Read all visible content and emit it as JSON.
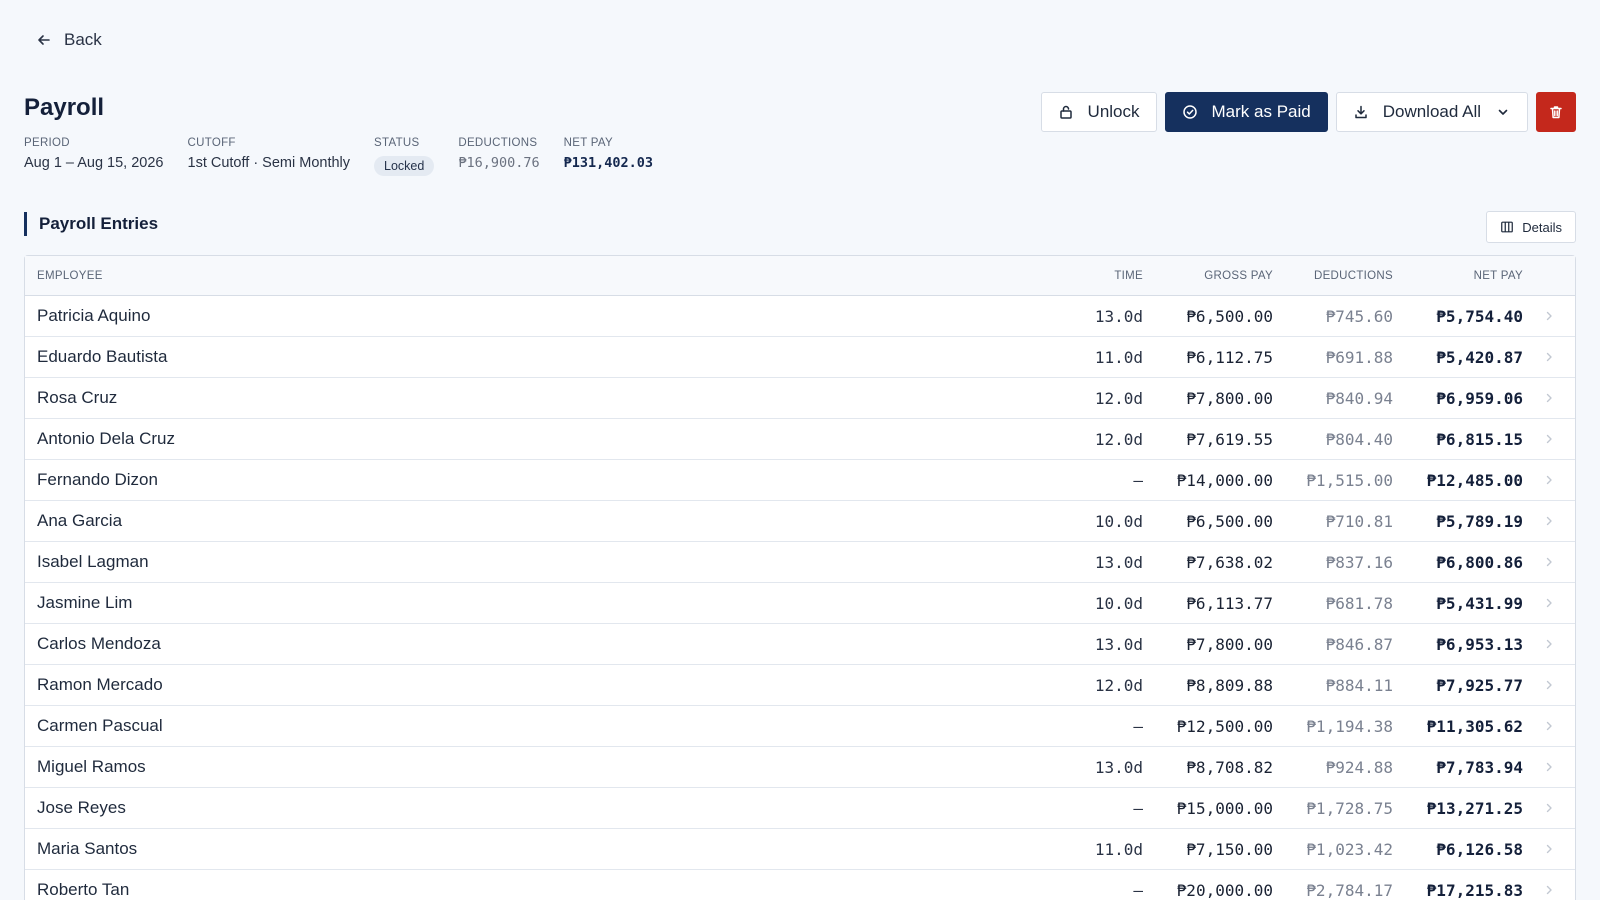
{
  "nav": {
    "back_label": "Back"
  },
  "page": {
    "title": "Payroll"
  },
  "meta": {
    "period": {
      "label": "PERIOD",
      "value": "Aug 1 – Aug 15, 2026"
    },
    "cutoff": {
      "label": "CUTOFF",
      "value": "1st Cutoff · Semi Monthly"
    },
    "status": {
      "label": "STATUS",
      "value": "Locked"
    },
    "deductions": {
      "label": "DEDUCTIONS",
      "value": "₱16,900.76"
    },
    "net_pay": {
      "label": "NET PAY",
      "value": "₱131,402.03"
    }
  },
  "actions": {
    "unlock_label": "Unlock",
    "mark_paid_label": "Mark as Paid",
    "download_label": "Download All",
    "delete_icon": "trash-icon"
  },
  "section": {
    "title": "Payroll Entries",
    "details_label": "Details"
  },
  "table": {
    "headers": {
      "employee": "EMPLOYEE",
      "time": "TIME",
      "gross": "GROSS PAY",
      "deductions": "DEDUCTIONS",
      "net": "NET PAY"
    },
    "rows": [
      {
        "name": "Patricia Aquino",
        "time": "13.0d",
        "gross": "₱6,500.00",
        "deductions": "₱745.60",
        "net": "₱5,754.40"
      },
      {
        "name": "Eduardo Bautista",
        "time": "11.0d",
        "gross": "₱6,112.75",
        "deductions": "₱691.88",
        "net": "₱5,420.87"
      },
      {
        "name": "Rosa Cruz",
        "time": "12.0d",
        "gross": "₱7,800.00",
        "deductions": "₱840.94",
        "net": "₱6,959.06"
      },
      {
        "name": "Antonio Dela Cruz",
        "time": "12.0d",
        "gross": "₱7,619.55",
        "deductions": "₱804.40",
        "net": "₱6,815.15"
      },
      {
        "name": "Fernando Dizon",
        "time": "–",
        "gross": "₱14,000.00",
        "deductions": "₱1,515.00",
        "net": "₱12,485.00"
      },
      {
        "name": "Ana Garcia",
        "time": "10.0d",
        "gross": "₱6,500.00",
        "deductions": "₱710.81",
        "net": "₱5,789.19"
      },
      {
        "name": "Isabel Lagman",
        "time": "13.0d",
        "gross": "₱7,638.02",
        "deductions": "₱837.16",
        "net": "₱6,800.86"
      },
      {
        "name": "Jasmine Lim",
        "time": "10.0d",
        "gross": "₱6,113.77",
        "deductions": "₱681.78",
        "net": "₱5,431.99"
      },
      {
        "name": "Carlos Mendoza",
        "time": "13.0d",
        "gross": "₱7,800.00",
        "deductions": "₱846.87",
        "net": "₱6,953.13"
      },
      {
        "name": "Ramon Mercado",
        "time": "12.0d",
        "gross": "₱8,809.88",
        "deductions": "₱884.11",
        "net": "₱7,925.77"
      },
      {
        "name": "Carmen Pascual",
        "time": "–",
        "gross": "₱12,500.00",
        "deductions": "₱1,194.38",
        "net": "₱11,305.62"
      },
      {
        "name": "Miguel Ramos",
        "time": "13.0d",
        "gross": "₱8,708.82",
        "deductions": "₱924.88",
        "net": "₱7,783.94"
      },
      {
        "name": "Jose Reyes",
        "time": "–",
        "gross": "₱15,000.00",
        "deductions": "₱1,728.75",
        "net": "₱13,271.25"
      },
      {
        "name": "Maria Santos",
        "time": "11.0d",
        "gross": "₱7,150.00",
        "deductions": "₱1,023.42",
        "net": "₱6,126.58"
      },
      {
        "name": "Roberto Tan",
        "time": "–",
        "gross": "₱20,000.00",
        "deductions": "₱2,784.17",
        "net": "₱17,215.83"
      }
    ]
  },
  "colors": {
    "primary": "#15305e",
    "danger": "#c4281c",
    "background": "#f5f8fc",
    "badge_bg": "#e4eaf2"
  }
}
